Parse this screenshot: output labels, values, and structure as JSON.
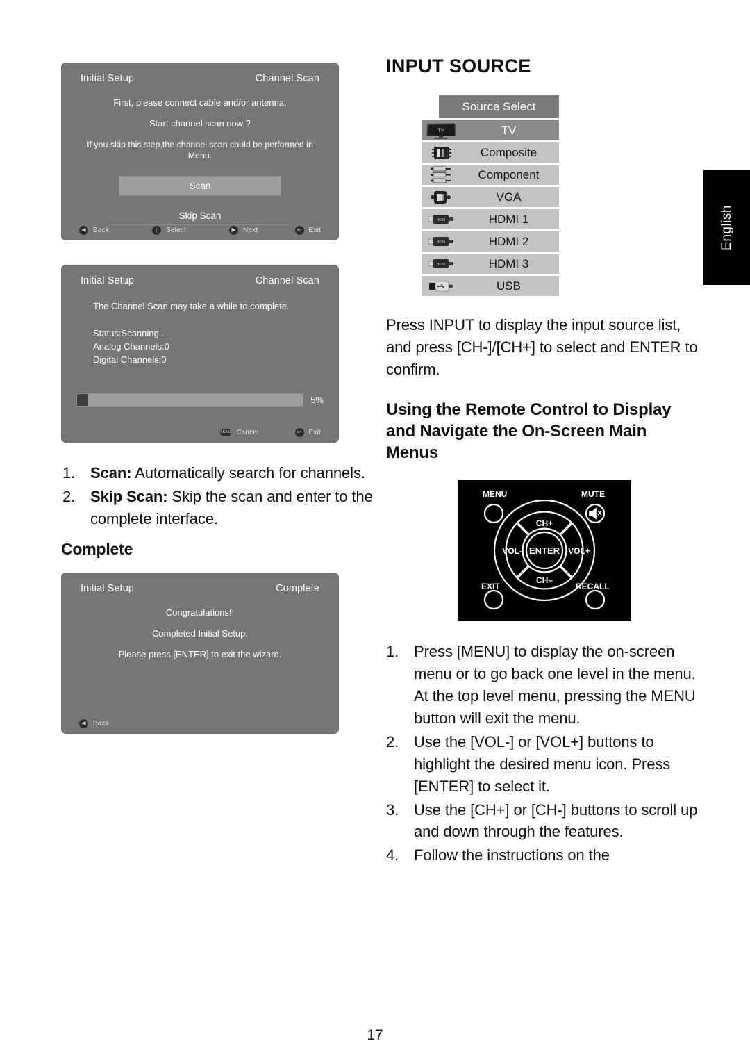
{
  "page": {
    "number": "17",
    "language_tab": "English"
  },
  "left_column": {
    "dialog_scan_prompt": {
      "header_left": "Initial Setup",
      "header_right": "Channel Scan",
      "lines": [
        "First, please connect cable and/or antenna.",
        "Start channel scan now ?",
        "If you skip this step,the channel scan could be performed in Menu."
      ],
      "primary_button": "Scan",
      "secondary_button": "Skip Scan",
      "footer_hints": [
        {
          "icon": "left-arrow-icon",
          "glyph": "◀",
          "label": "Back"
        },
        {
          "icon": "up-down-arrow-icon",
          "glyph": "⬍",
          "label": "Select"
        },
        {
          "icon": "right-arrow-icon",
          "glyph": "▶",
          "label": "Next"
        },
        {
          "icon": "return-arrow-icon",
          "glyph": "↩",
          "label": "Exit"
        }
      ]
    },
    "dialog_scanning": {
      "header_left": "Initial Setup",
      "header_right": "Channel Scan",
      "notice": "The Channel Scan may take a while to complete.",
      "status_lines": [
        "Status:Scanning..",
        "Analog Channels:0",
        "Digital Channels:0"
      ],
      "progress_percent": "5%",
      "progress_value": 5,
      "footer_hints": [
        {
          "icon": "menu-button-icon",
          "glyph": "MENU",
          "label": "Cancel"
        },
        {
          "icon": "return-arrow-icon",
          "glyph": "↩",
          "label": "Exit"
        }
      ]
    },
    "list": [
      {
        "number": "1.",
        "bold": "Scan:",
        "text": " Automatically search for channels."
      },
      {
        "number": "2.",
        "bold": "Skip Scan:",
        "text": " Skip the scan and enter to the complete interface."
      }
    ],
    "complete_heading": "Complete",
    "dialog_complete": {
      "header_left": "Initial Setup",
      "header_right": "Complete",
      "lines": [
        "Congratulations!!",
        "Completed Initial Setup.",
        "Please press [ENTER] to exit the wizard."
      ],
      "footer_hints": [
        {
          "icon": "left-arrow-icon",
          "glyph": "◀",
          "label": "Back"
        }
      ]
    }
  },
  "right_column": {
    "title": "INPUT SOURCE",
    "source_select": {
      "header": "Source Select",
      "items": [
        {
          "label": "TV",
          "icon": "tv-icon",
          "selected": true
        },
        {
          "label": "Composite",
          "icon": "composite-connector-icon",
          "selected": false
        },
        {
          "label": "Component",
          "icon": "component-connector-icon",
          "selected": false
        },
        {
          "label": "VGA",
          "icon": "vga-connector-icon",
          "selected": false
        },
        {
          "label": "HDMI 1",
          "icon": "hdmi-connector-icon",
          "selected": false
        },
        {
          "label": "HDMI 2",
          "icon": "hdmi-connector-icon",
          "selected": false
        },
        {
          "label": "HDMI 3",
          "icon": "hdmi-connector-icon",
          "selected": false
        },
        {
          "label": "USB",
          "icon": "usb-connector-icon",
          "selected": false
        }
      ]
    },
    "intro_paragraph": "Press INPUT  to display the input source list, and press [CH-]/[CH+] to select and ENTER to confirm.",
    "section_heading": "Using the Remote Control to Display and Navigate the On-Screen Main Menus",
    "remote": {
      "menu": "MENU",
      "mute": "MUTE",
      "ch_up": "CH+",
      "ch_down": "CH–",
      "vol_down": "VOL–",
      "vol_up": "VOL+",
      "enter": "ENTER",
      "exit": "EXIT",
      "recall": "RECALL"
    },
    "steps": [
      {
        "number": "1.",
        "text": "Press [MENU] to display the on-screen menu or to go back one level in the menu. At the top level menu, pressing the MENU button will exit the menu."
      },
      {
        "number": "2.",
        "text": "Use the [VOL-] or [VOL+] buttons to highlight the desired menu icon. Press [ENTER] to select it."
      },
      {
        "number": "3.",
        "text": "Use the [CH+] or [CH-] buttons to scroll up and down through the features."
      },
      {
        "number": "4.",
        "text": "Follow the instructions on the"
      }
    ]
  },
  "colors": {
    "osd_bg": "#767676",
    "osd_button": "#9c9c9c",
    "source_header": "#7b7b7b",
    "source_row": "#c3c3c3",
    "source_row_selected": "#8b8b8b",
    "remote_bg": "#000000",
    "tab_bg": "#000000"
  }
}
